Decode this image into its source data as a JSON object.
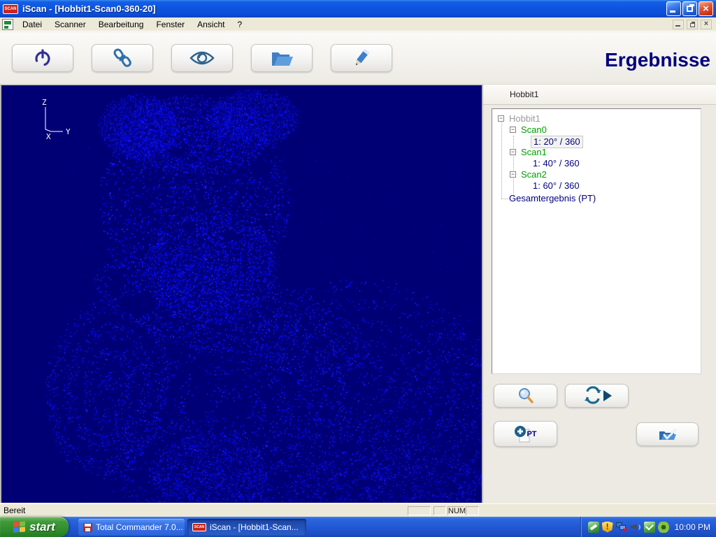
{
  "window": {
    "title": "iScan - [Hobbit1-Scan0-360-20]",
    "logo_text": "SCAN"
  },
  "menubar": {
    "items": [
      "Datei",
      "Scanner",
      "Bearbeitung",
      "Fenster",
      "Ansicht",
      "?"
    ]
  },
  "toolbar": {
    "heading": "Ergebnisse",
    "button_icons": [
      "power-icon",
      "connect-icon",
      "view-icon",
      "open-folder-icon",
      "edit-pencil-icon"
    ]
  },
  "viewport": {
    "background": "#000074",
    "point_color": "#0a0af5",
    "axis_labels": {
      "z": "Z",
      "x": "X",
      "y": "Y"
    }
  },
  "results": {
    "header": "Hobbit1",
    "tree": [
      {
        "label": "Hobbit1",
        "level": 0,
        "color": "gray",
        "expanded": true
      },
      {
        "label": "Scan0",
        "level": 1,
        "color": "green",
        "expanded": true
      },
      {
        "label": "1: 20° / 360",
        "level": 2,
        "color": "navy",
        "selected": true
      },
      {
        "label": "Scan1",
        "level": 1,
        "color": "green",
        "expanded": true
      },
      {
        "label": "1: 40° / 360",
        "level": 2,
        "color": "navy"
      },
      {
        "label": "Scan2",
        "level": 1,
        "color": "green",
        "expanded": true
      },
      {
        "label": "1: 60° / 360",
        "level": 2,
        "color": "navy"
      },
      {
        "label": "Gesamtergebnis (PT)",
        "level": 0,
        "color": "navy"
      }
    ],
    "expander_glyph": "−",
    "add_pt_label": "PT",
    "button_icons": [
      "search-icon",
      "replay-icon",
      "add-pt-icon",
      "accept-icon"
    ]
  },
  "statusbar": {
    "ready": "Bereit",
    "num": "NUM"
  },
  "taskbar": {
    "start_label": "start",
    "tasks": [
      {
        "label": "Total Commander 7.0..."
      },
      {
        "label": "iScan - [Hobbit1-Scan..."
      }
    ],
    "tray_icons": [
      "shared-folder-icon",
      "security-shield-icon",
      "network-offline-icon",
      "volume-icon",
      "vm-tools-icon",
      "nvidia-icon"
    ],
    "clock": "10:00 PM"
  }
}
